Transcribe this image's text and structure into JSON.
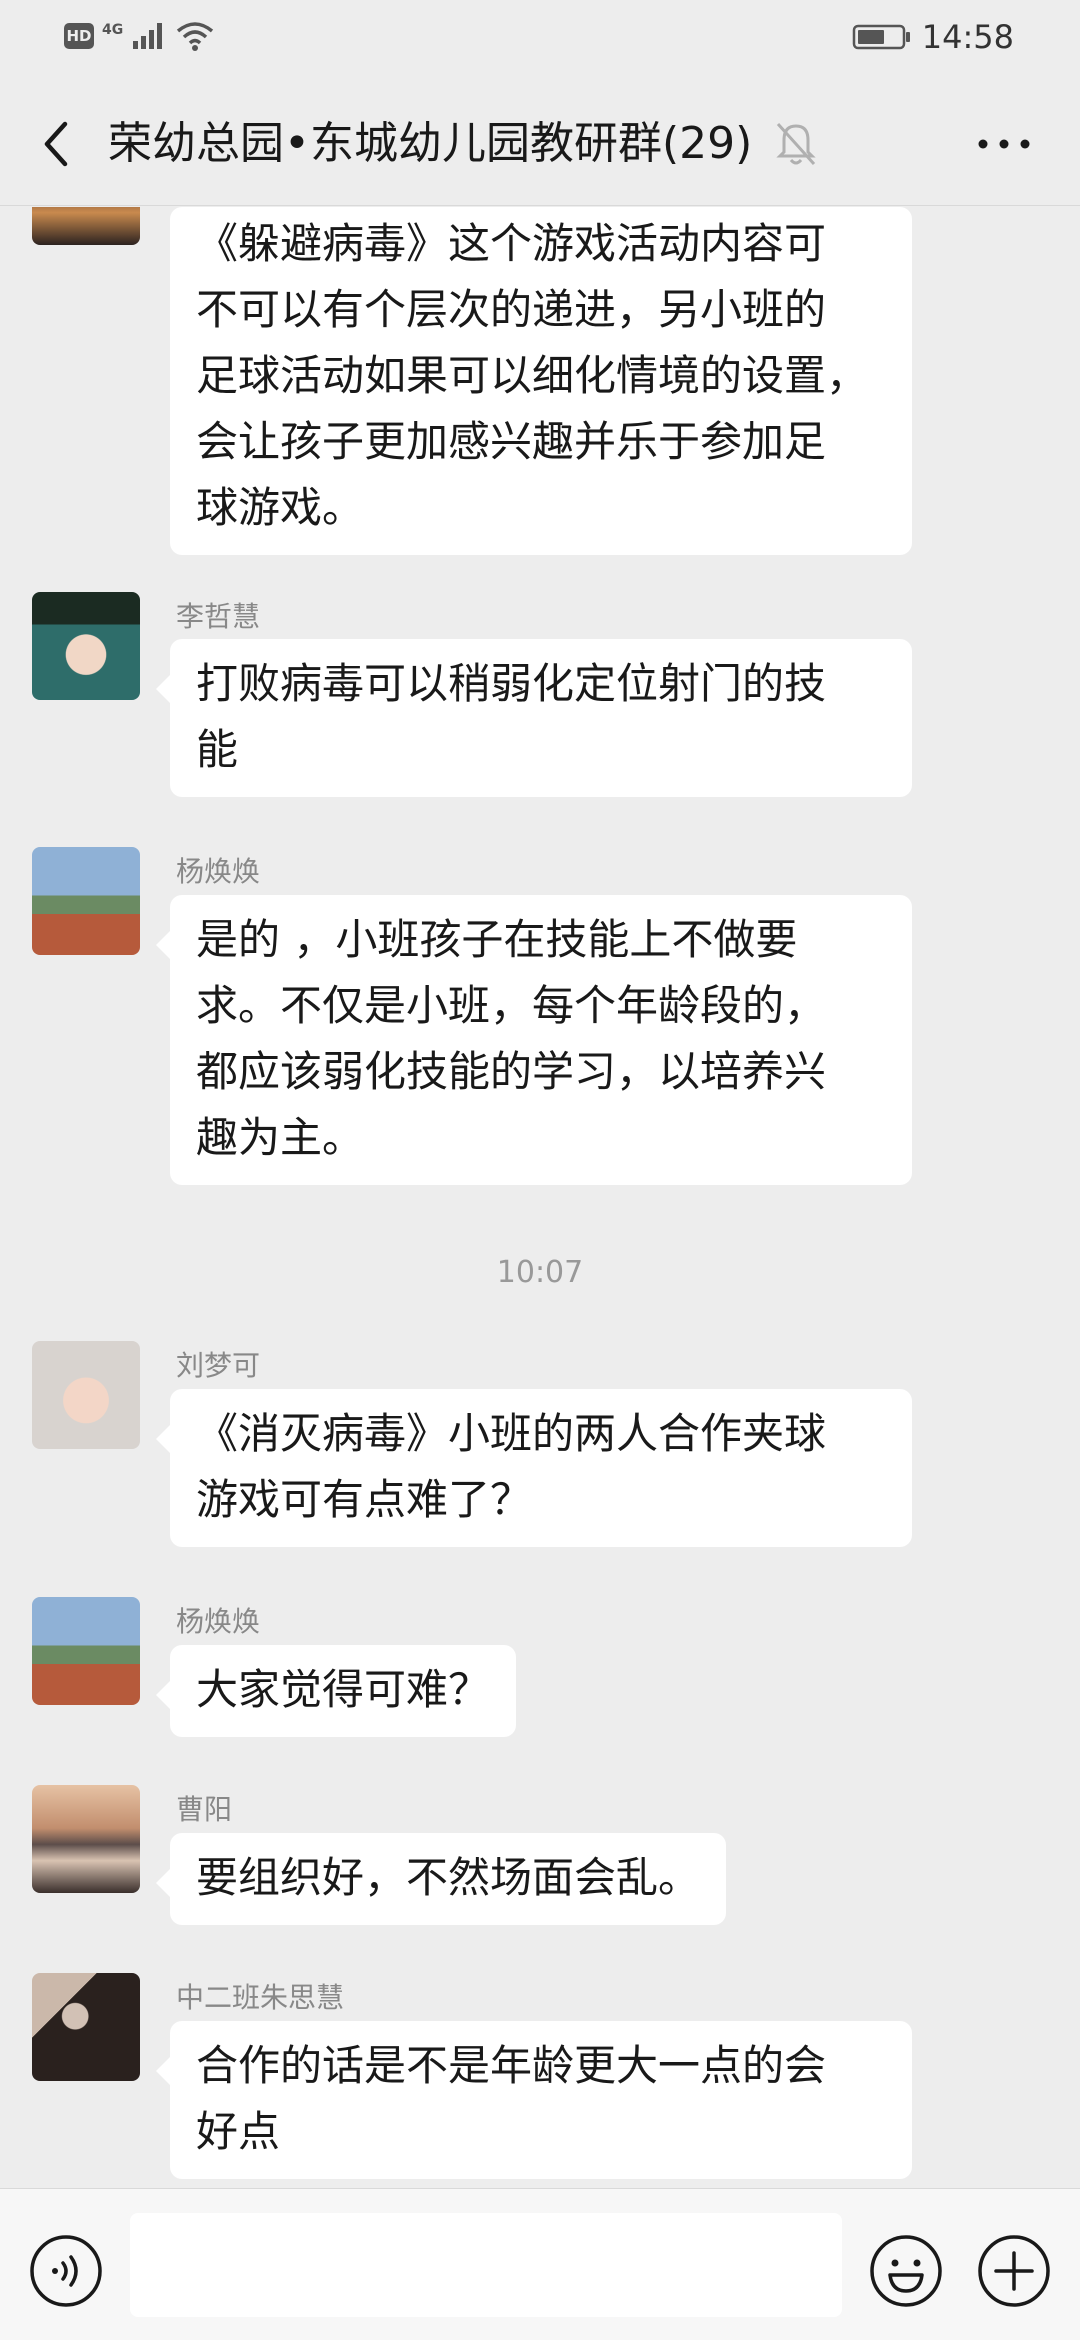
{
  "status_bar": {
    "hd": "HD",
    "network": "4G",
    "time": "14:58"
  },
  "header": {
    "title": "荣幼总园•东城幼儿园教研群(29)"
  },
  "messages": [
    {
      "sender": "",
      "avatar": "sunset-avatar",
      "lines": [
        "《躲避病毒》这个游戏活动内容可",
        "不可以有个层次的递进，另小班的",
        "足球活动如果可以细化情境的设置，",
        "会让孩子更加感兴趣并乐于参加足",
        "球游戏。"
      ]
    },
    {
      "sender": "李哲慧",
      "avatar": "girl-avatar",
      "lines": [
        "打败病毒可以稍弱化定位射门的技",
        "能"
      ]
    },
    {
      "sender": "杨焕焕",
      "avatar": "group-photo-avatar",
      "lines": [
        "是的 ，小班孩子在技能上不做要",
        "求。不仅是小班，每个年龄段的，",
        "都应该弱化技能的学习，以培养兴",
        "趣为主。"
      ]
    },
    {
      "sender": "刘梦可",
      "avatar": "child-avatar",
      "lines": [
        "《消灭病毒》小班的两人合作夹球",
        "游戏可有点难了？"
      ]
    },
    {
      "sender": "杨焕焕",
      "avatar": "group-photo-avatar",
      "lines": [
        "大家觉得可难？"
      ]
    },
    {
      "sender": "曹阳",
      "avatar": "lake-sunset-avatar",
      "lines": [
        "要组织好，不然场面会乱。"
      ]
    },
    {
      "sender": "中二班朱思慧",
      "avatar": "silhouette-avatar",
      "lines": [
        "合作的话是不是年龄更大一点的会",
        "好点"
      ]
    }
  ],
  "timestamp": "10:07",
  "input": {
    "placeholder": ""
  },
  "icons": {
    "back": "chevron-left-icon",
    "mute": "bell-off-icon",
    "more": "more-dots-icon",
    "voice": "voice-icon",
    "emoji": "emoji-icon",
    "plus": "plus-icon"
  },
  "colors": {
    "background": "#ededed",
    "bubble": "#ffffff",
    "sender_text": "#888888"
  }
}
